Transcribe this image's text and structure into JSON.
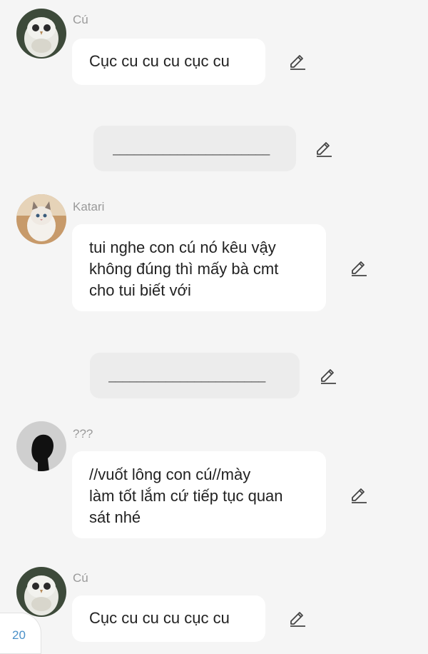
{
  "messages": [
    {
      "name": "Cú",
      "text": "Cục cu cu cu cục cu"
    },
    {
      "separator": "______________________"
    },
    {
      "name": "Katari",
      "lines": [
        "tui nghe con cú nó kêu vậy",
        "không đúng thì mấy bà cmt",
        "cho tui biết với"
      ]
    },
    {
      "separator": "______________________"
    },
    {
      "name": "???",
      "lines": [
        "//vuốt lông con cú//mày",
        "làm tốt lắm cứ tiếp tục quan",
        "sát nhé"
      ]
    },
    {
      "name": "Cú",
      "text": "Cục cu cu cu cục cu"
    }
  ],
  "page_counter": "20",
  "icons": {
    "edit": "pencil-edit-icon",
    "owl_avatar": "owl-avatar",
    "cat_avatar": "cat-avatar",
    "silhouette_avatar": "silhouette-avatar"
  },
  "colors": {
    "background": "#f5f5f5",
    "bubble": "#ffffff",
    "separator_bubble": "#ececec",
    "name": "#9a9a9a",
    "counter": "#4a90c8"
  }
}
